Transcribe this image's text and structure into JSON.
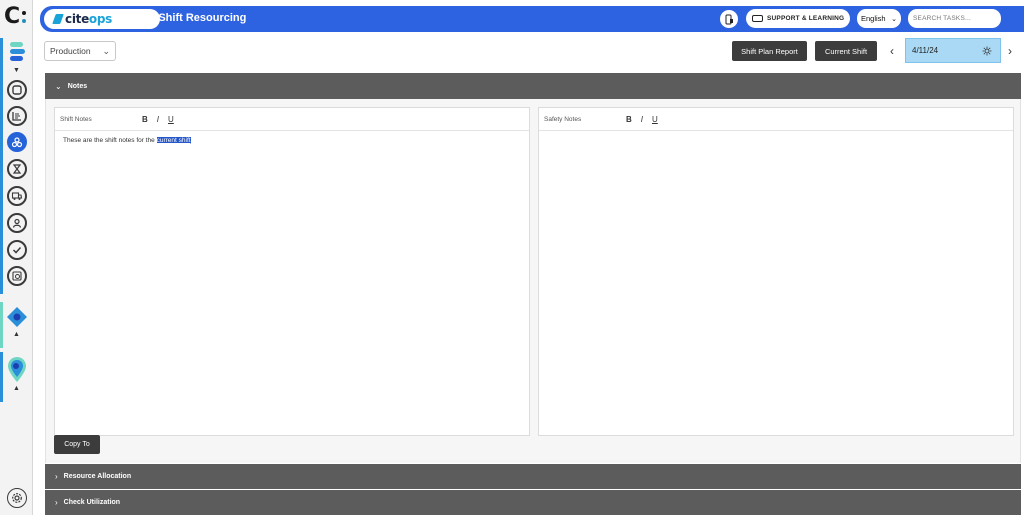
{
  "header": {
    "brand_cite": "cite",
    "brand_ops": "ops",
    "page_title": "My Shift Resourcing",
    "support_label": "SUPPORT & LEARNING",
    "language": "English",
    "search_placeholder": "SEARCH TASKS..."
  },
  "toolbar": {
    "department": "Production",
    "shift_plan_report": "Shift Plan Report",
    "current_shift": "Current Shift",
    "date": "4/11/24"
  },
  "sections": {
    "notes": "Notes",
    "resource_allocation": "Resource Allocation",
    "check_utilization": "Check Utilization"
  },
  "shift_notes": {
    "title": "Shift Notes",
    "text_before": "These are the shift notes for the ",
    "text_selected": "current shift"
  },
  "safety_notes": {
    "title": "Safety Notes"
  },
  "format": {
    "bold": "B",
    "italic": "I",
    "underline": "U"
  },
  "copy_to": "Copy To",
  "colors": {
    "header_blue": "#2d62e0",
    "section_gray": "#5c5c5c",
    "date_highlight": "#a9d9f5",
    "active_rail": "#2463d8"
  },
  "icons": [
    "home-icon",
    "tasks-icon",
    "resourcing-icon",
    "hourglass-icon",
    "truck-icon",
    "user-icon",
    "check-icon",
    "report-icon",
    "settings-icon"
  ]
}
